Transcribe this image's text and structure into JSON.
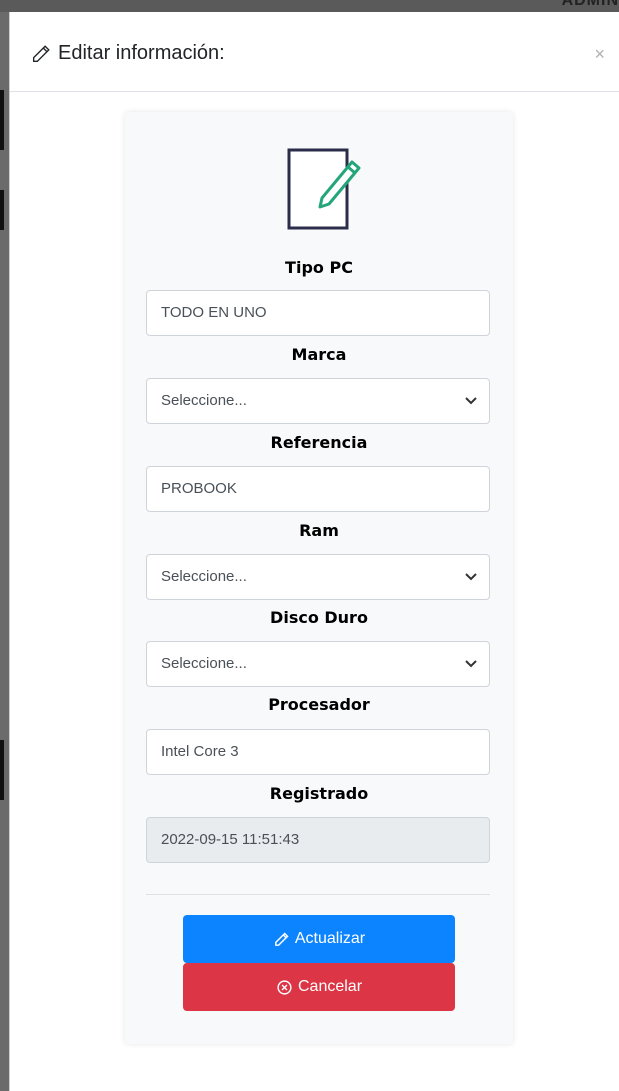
{
  "backdrop": {
    "partial_text": "ADMIN"
  },
  "modal": {
    "title": "Editar información:",
    "close_glyph": "×"
  },
  "form": {
    "tipo_pc": {
      "label": "Tipo PC",
      "value": "TODO EN UNO"
    },
    "marca": {
      "label": "Marca",
      "value": "Seleccione..."
    },
    "referencia": {
      "label": "Referencia",
      "value": "PROBOOK"
    },
    "ram": {
      "label": "Ram",
      "value": "Seleccione..."
    },
    "disco_duro": {
      "label": "Disco Duro",
      "value": "Seleccione..."
    },
    "procesador": {
      "label": "Procesador",
      "value": "Intel Core 3"
    },
    "registrado": {
      "label": "Registrado",
      "value": "2022-09-15 11:51:43"
    }
  },
  "buttons": {
    "update_label": "Actualizar",
    "cancel_label": "Cancelar"
  },
  "icons": {
    "title": "pencil-icon",
    "card": "edit-document-icon",
    "update": "pencil-icon",
    "cancel": "circle-x-icon",
    "select": "chevron-down-icon"
  },
  "colors": {
    "primary": "#0d84ff",
    "danger": "#dc3545",
    "doc_outline": "#2b2d4a",
    "doc_pencil": "#25a57a"
  }
}
